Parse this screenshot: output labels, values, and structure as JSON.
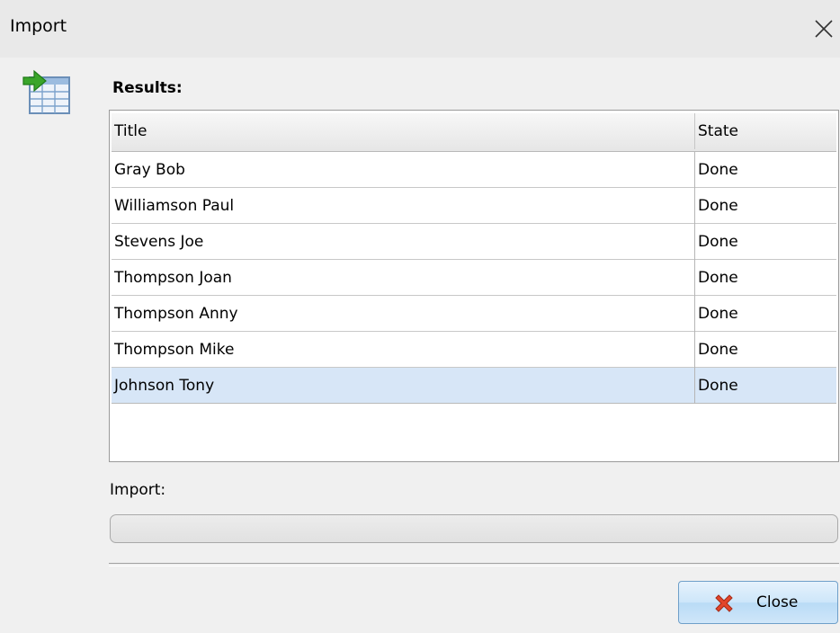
{
  "window": {
    "title": "Import"
  },
  "results": {
    "label": "Results:",
    "columns": [
      "Title",
      "State"
    ],
    "rows": [
      {
        "title": "Gray Bob",
        "state": "Done"
      },
      {
        "title": "Williamson Paul",
        "state": "Done"
      },
      {
        "title": "Stevens Joe",
        "state": "Done"
      },
      {
        "title": "Thompson Joan",
        "state": "Done"
      },
      {
        "title": "Thompson Anny",
        "state": "Done"
      },
      {
        "title": "Thompson Mike",
        "state": "Done"
      },
      {
        "title": "Johnson Tony",
        "state": "Done",
        "selected": true
      }
    ]
  },
  "import": {
    "label": "Import:",
    "progress": 0
  },
  "footer": {
    "close_label": "Close"
  },
  "icons": {
    "window_close": "close-icon",
    "import": "table-import-icon",
    "close_button": "red-x-icon"
  },
  "colors": {
    "selection": "#d7e6f7",
    "button": "#cde6fa",
    "icon_arrow": "#3aa52a",
    "close_x": "#e2452b"
  }
}
